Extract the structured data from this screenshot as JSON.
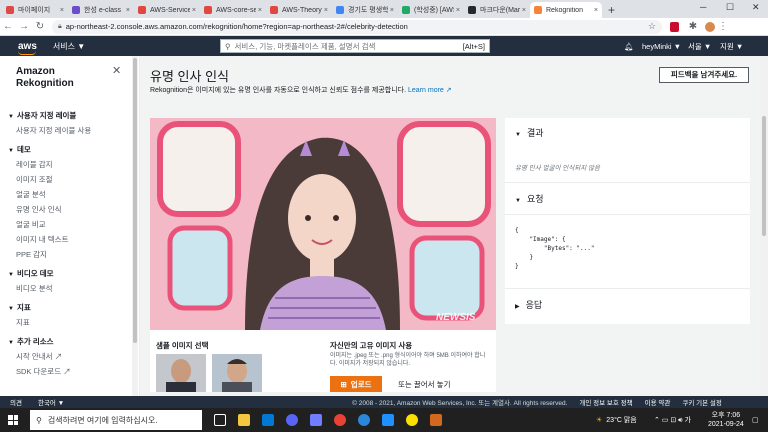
{
  "browser": {
    "tabs": [
      {
        "label": "마이페이지",
        "color": "#e04848",
        "active": false
      },
      {
        "label": "한성 e-class",
        "color": "#6a4fc9",
        "active": false
      },
      {
        "label": "AWS-Service",
        "color": "#e0483f",
        "active": false
      },
      {
        "label": "AWS-core-se",
        "color": "#e0483f",
        "active": false
      },
      {
        "label": "AWS-Theory",
        "color": "#e0483f",
        "active": false
      },
      {
        "label": "경기도 평생학",
        "color": "#4285f4",
        "active": false
      },
      {
        "label": "(학성중) [AWS",
        "color": "#22a86b",
        "active": false
      },
      {
        "label": "마크다운(Mar",
        "color": "#24292e",
        "active": false
      },
      {
        "label": "Rekognition",
        "color": "#f58536",
        "active": true
      }
    ],
    "new_tab_label": "+",
    "url": "ap-northeast-2.console.aws.amazon.com/rekognition/home?region=ap-northeast-2#/celebrity-detection"
  },
  "aws_nav": {
    "logo": "aws",
    "services_label": "서비스 ▼",
    "search_placeholder": "서비스, 기능, 마켓플레이스 제품, 설명서 검색",
    "search_shortcut": "[Alt+S]",
    "user": "heyMinki ▼",
    "region": "서울 ▼",
    "support": "지원 ▼"
  },
  "sidebar": {
    "title_line1": "Amazon",
    "title_line2": "Rekognition",
    "sections": [
      {
        "label": "사용자 지정 레이블",
        "items": [
          "사용자 지정 레이블 사용"
        ]
      },
      {
        "label": "데모",
        "items": [
          "레이블 감지",
          "이미지 조절",
          "얼굴 분석",
          "유명 인사 인식",
          "얼굴 비교",
          "이미지 내 텍스트",
          "PPE 감지"
        ]
      },
      {
        "label": "비디오 데모",
        "items": [
          "비디오 분석"
        ]
      },
      {
        "label": "지표",
        "items": [
          "지표"
        ]
      },
      {
        "label": "추가 리소스",
        "items": [
          "시작 안내서",
          "SDK 다운로드"
        ]
      }
    ]
  },
  "main": {
    "title": "유명 인사 인식",
    "description": "Rekognition은 이미지에 있는 유명 인사를 자동으로 인식하고 신뢰도 점수를 제공합니다.",
    "learn_more": "Learn more",
    "feedback_button": "피드백을 남겨주세요.",
    "watermark": "NEWSIS",
    "sample_title": "샘플 이미지 선택",
    "own_title": "자신만의 고유 이미지 사용",
    "own_desc": "이미지는 .jpeg 또는 .png 형식이어야 하며 5MB 이하여야 합니다. 이미지가 저장되지 않습니다.",
    "upload_button": "업로드",
    "drag_text": "또는 끌어서 놓기",
    "results_header": "결과",
    "results_empty": "유명 인사 얼굴이 인식되지 않음",
    "request_header": "요청",
    "request_code": "{\n    \"Image\": {\n        \"Bytes\": \"...\"\n    }\n}",
    "response_header": "응답"
  },
  "footer": {
    "feedback": "의견",
    "language": "한국어 ▼",
    "copyright": "© 2008 - 2021, Amazon Web Services, Inc. 또는 계열사. All rights reserved.",
    "privacy": "개인 정보 보호 정책",
    "terms": "이용 약관",
    "cookie": "쿠키 기본 설정"
  },
  "taskbar": {
    "search_placeholder": "검색하려면 여기에 입력하십시오.",
    "weather": "23°C 맑음",
    "time": "오후 7:06",
    "date": "2021-09-24"
  },
  "colors": {
    "aws_nav": "#232f3e",
    "accent": "#ec7211",
    "link": "#0073bb"
  }
}
